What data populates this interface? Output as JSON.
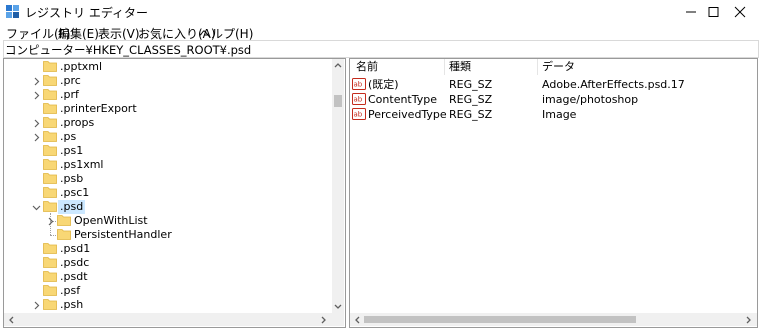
{
  "window": {
    "title": "レジストリ エディター"
  },
  "menu": [
    "ファイル(F)",
    "編集(E)",
    "表示(V)",
    "お気に入り(A)",
    "ヘルプ(H)"
  ],
  "address": "コンピューター¥HKEY_CLASSES_ROOT¥.psd",
  "tree": [
    {
      "label": ".pptxml",
      "level": 0,
      "arrow": "none"
    },
    {
      "label": ".prc",
      "level": 0,
      "arrow": "right"
    },
    {
      "label": ".prf",
      "level": 0,
      "arrow": "right"
    },
    {
      "label": ".printerExport",
      "level": 0,
      "arrow": "none"
    },
    {
      "label": ".props",
      "level": 0,
      "arrow": "right"
    },
    {
      "label": ".ps",
      "level": 0,
      "arrow": "right"
    },
    {
      "label": ".ps1",
      "level": 0,
      "arrow": "none"
    },
    {
      "label": ".ps1xml",
      "level": 0,
      "arrow": "none"
    },
    {
      "label": ".psb",
      "level": 0,
      "arrow": "none"
    },
    {
      "label": ".psc1",
      "level": 0,
      "arrow": "none"
    },
    {
      "label": ".psd",
      "level": 0,
      "arrow": "down",
      "selected": true
    },
    {
      "label": "OpenWithList",
      "level": 1,
      "arrow": "right"
    },
    {
      "label": "PersistentHandler",
      "level": 1,
      "arrow": "none"
    },
    {
      "label": ".psd1",
      "level": 0,
      "arrow": "none"
    },
    {
      "label": ".psdc",
      "level": 0,
      "arrow": "none"
    },
    {
      "label": ".psdt",
      "level": 0,
      "arrow": "none"
    },
    {
      "label": ".psf",
      "level": 0,
      "arrow": "none"
    },
    {
      "label": ".psh",
      "level": 0,
      "arrow": "right"
    }
  ],
  "columns": [
    "名前",
    "種類",
    "データ"
  ],
  "values": [
    {
      "name": "(既定)",
      "type": "REG_SZ",
      "data": "Adobe.AfterEffects.psd.17"
    },
    {
      "name": "ContentType",
      "type": "REG_SZ",
      "data": "image/photoshop"
    },
    {
      "name": "PerceivedType",
      "type": "REG_SZ",
      "data": "Image"
    }
  ],
  "colors": {
    "selection": "#cce8ff",
    "folder": "#f8d775",
    "folder_dark": "#e0b540",
    "ab_red": "#c42b1c"
  }
}
